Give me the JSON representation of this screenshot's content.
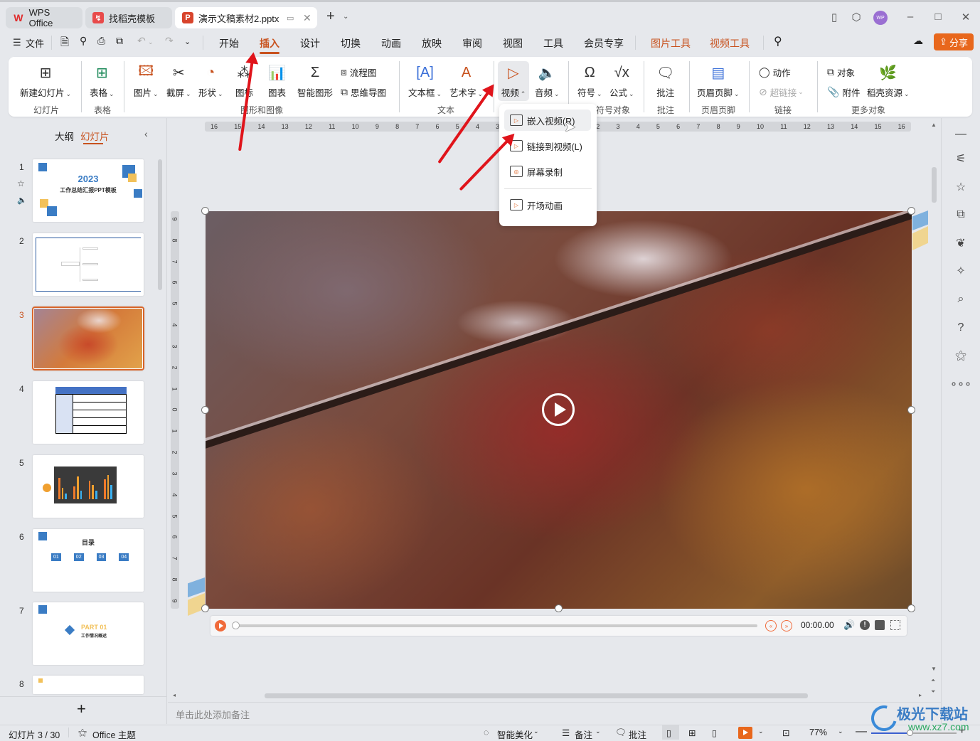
{
  "window": {
    "tabs": [
      {
        "label": "WPS Office",
        "icon": "wps-logo-icon",
        "active": false
      },
      {
        "label": "找稻壳模板",
        "icon": "docer-icon",
        "active": false
      },
      {
        "label": "演示文稿素材2.pptx",
        "icon": "presentation-icon",
        "active": true
      }
    ],
    "new_tab": "+",
    "avatar": "WP"
  },
  "menubar": {
    "file": "文件",
    "items": [
      "开始",
      "插入",
      "设计",
      "切换",
      "动画",
      "放映",
      "审阅",
      "视图",
      "工具",
      "会员专享"
    ],
    "active": "插入",
    "context_tools": [
      "图片工具",
      "视频工具"
    ],
    "share": "分享"
  },
  "ribbon": {
    "groups": {
      "slides": "幻灯片",
      "table": "表格",
      "graphics": "图形和图像",
      "text": "文本",
      "symbols": "符号对象",
      "comment": "批注",
      "header_footer": "页眉页脚",
      "link": "链接",
      "more_objects": "更多对象"
    },
    "buttons": {
      "new_slide": "新建幻灯片",
      "table": "表格",
      "picture": "图片",
      "screenshot": "截屏",
      "shape": "形状",
      "icon": "图标",
      "chart": "图表",
      "smartart": "智能图形",
      "flowchart": "流程图",
      "mindmap": "思维导图",
      "textbox": "文本框",
      "wordart": "艺术字",
      "video": "视频",
      "audio": "音频",
      "symbol": "符号",
      "formula": "公式",
      "comment": "批注",
      "header_footer": "页眉页脚",
      "action": "动作",
      "hyperlink": "超链接",
      "object": "对象",
      "attachment": "附件",
      "docer_resources": "稻壳资源"
    }
  },
  "video_dropdown": {
    "items": [
      {
        "label": "嵌入视频(R)",
        "icon": "embed-video-icon",
        "hovered": true
      },
      {
        "label": "链接到视频(L)",
        "icon": "link-video-icon"
      },
      {
        "label": "屏幕录制",
        "icon": "screen-record-icon"
      },
      {
        "label": "开场动画",
        "icon": "opening-animation-icon"
      }
    ]
  },
  "left_panel": {
    "tabs": [
      "大纲",
      "幻灯片"
    ],
    "active_tab": "幻灯片",
    "slides": [
      {
        "num": "1",
        "title": "2023",
        "subtitle": "工作总结汇报PPT模板"
      },
      {
        "num": "2"
      },
      {
        "num": "3",
        "selected": true
      },
      {
        "num": "4"
      },
      {
        "num": "5"
      },
      {
        "num": "6",
        "title": "目录",
        "items": [
          "01",
          "02",
          "03",
          "04"
        ]
      },
      {
        "num": "7",
        "title": "PART 01",
        "subtitle": "工作情况概述"
      },
      {
        "num": "8"
      }
    ],
    "add": "+"
  },
  "ruler": {
    "horizontal": [
      "16",
      "15",
      "14",
      "13",
      "12",
      "11",
      "10",
      "9",
      "8",
      "7",
      "6",
      "5",
      "4",
      "3",
      "2",
      "1",
      "0",
      "1",
      "2",
      "3",
      "4",
      "5",
      "6",
      "7",
      "8",
      "9",
      "10",
      "11",
      "12",
      "13",
      "14",
      "15",
      "16"
    ],
    "vertical": [
      "9",
      "8",
      "7",
      "6",
      "5",
      "4",
      "3",
      "2",
      "1",
      "0",
      "1",
      "2",
      "3",
      "4",
      "5",
      "6",
      "7",
      "8",
      "9"
    ]
  },
  "video_player": {
    "time": "00:00.00",
    "progress": 0
  },
  "notes_placeholder": "单击此处添加备注",
  "statusbar": {
    "slide_info": "幻灯片 3 / 30",
    "theme": "Office 主题",
    "beautify": "智能美化",
    "notes": "备注",
    "comment": "批注",
    "zoom": "77%",
    "zoom_fraction": 0.45
  },
  "watermark": {
    "name": "极光下载站",
    "url": "www.xz7.com"
  },
  "colors": {
    "accent": "#c8521e",
    "share_bg": "#e8671c",
    "arrow": "#e0141b",
    "avatar": "#9a6fd2"
  }
}
